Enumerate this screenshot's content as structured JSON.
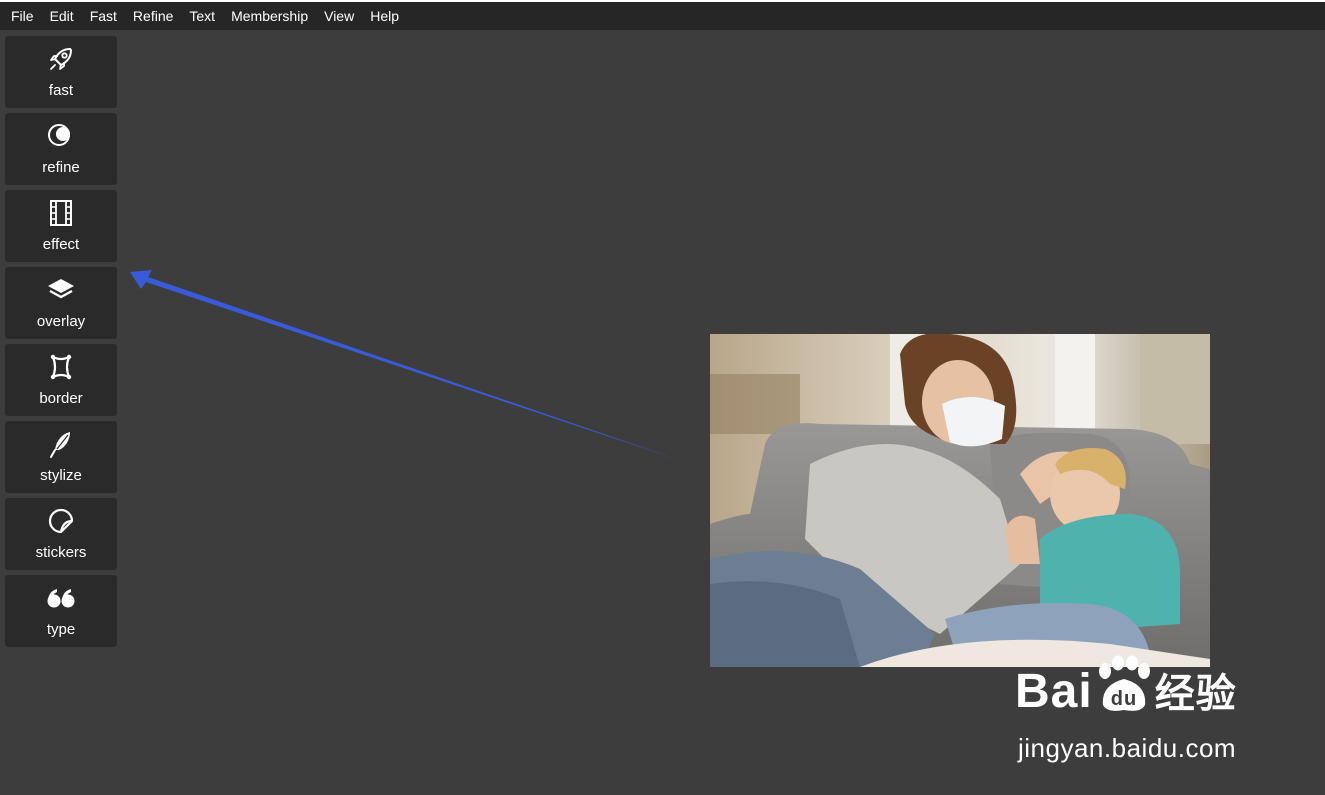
{
  "menu": [
    "File",
    "Edit",
    "Fast",
    "Refine",
    "Text",
    "Membership",
    "View",
    "Help"
  ],
  "sidebar": {
    "items": [
      {
        "label": "fast",
        "icon": "rocket-icon"
      },
      {
        "label": "refine",
        "icon": "circles-icon"
      },
      {
        "label": "effect",
        "icon": "film-icon"
      },
      {
        "label": "overlay",
        "icon": "layers-icon"
      },
      {
        "label": "border",
        "icon": "frame-icon"
      },
      {
        "label": "stylize",
        "icon": "feather-icon"
      },
      {
        "label": "stickers",
        "icon": "sticker-icon"
      },
      {
        "label": "type",
        "icon": "quote-icon"
      }
    ]
  },
  "watermark": {
    "logo_bai": "Bai",
    "logo_du": "du",
    "logo_cn": "经验",
    "url": "jingyan.baidu.com"
  },
  "colors": {
    "canvas_bg": "#3d3d3d",
    "menubar_bg": "#262626",
    "tool_bg": "#2a2a2a",
    "arrow": "#3a5bd9"
  }
}
